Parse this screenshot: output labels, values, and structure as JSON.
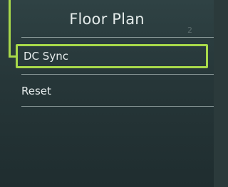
{
  "header": {
    "title": "Floor Plan",
    "scroll_hint": "2"
  },
  "menu": {
    "items": [
      {
        "label": "DC Sync",
        "selected": true
      },
      {
        "label": "Reset",
        "selected": false
      }
    ]
  },
  "colors": {
    "background": "#263638",
    "highlight": "#a8d94a",
    "text": "#e6ecec",
    "divider": "#8f9e9d"
  }
}
